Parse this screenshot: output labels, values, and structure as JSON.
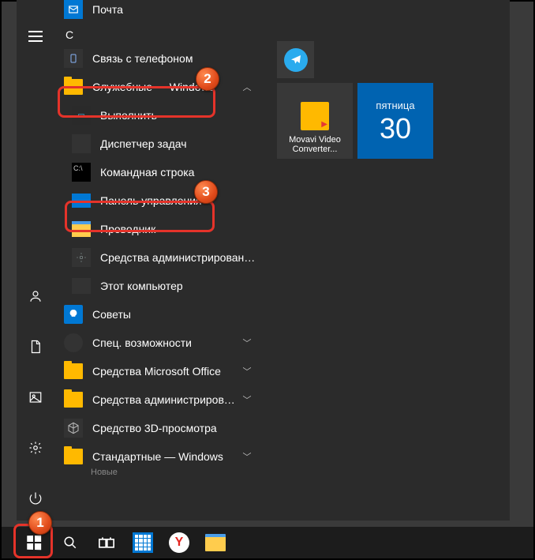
{
  "start_menu": {
    "letter_header": "С",
    "mail_label": "Почта",
    "items": [
      {
        "label": "Связь с телефоном",
        "type": "app"
      },
      {
        "label": "Служебные — Windows",
        "type": "folder-expandable",
        "expanded": true
      },
      {
        "label": "Выполнить",
        "type": "run",
        "sub": true
      },
      {
        "label": "Диспетчер задач",
        "type": "dark",
        "sub": true
      },
      {
        "label": "Командная строка",
        "type": "cmd",
        "sub": true
      },
      {
        "label": "Панель управления",
        "type": "cpl",
        "sub": true
      },
      {
        "label": "Проводник",
        "type": "exp",
        "sub": true
      },
      {
        "label": "Средства администрирования Wi...",
        "type": "settings",
        "sub": true
      },
      {
        "label": "Этот компьютер",
        "type": "pc",
        "sub": true
      },
      {
        "label": "Советы",
        "type": "tips"
      },
      {
        "label": "Спец. возможности",
        "type": "ease",
        "expand": true
      },
      {
        "label": "Средства Microsoft Office",
        "type": "folder",
        "expand": true
      },
      {
        "label": "Средства администрирования...",
        "type": "folder",
        "expand": true
      },
      {
        "label": "Средство 3D-просмотра",
        "type": "3d"
      },
      {
        "label": "Стандартные — Windows",
        "type": "folder",
        "expand": true
      }
    ],
    "new_label": "Новые"
  },
  "tiles": {
    "movavi": "Movavi Video Converter...",
    "calendar_day": "пятница",
    "calendar_num": "30"
  },
  "callouts": {
    "b1": "1",
    "b2": "2",
    "b3": "3"
  },
  "taskbar": {
    "yandex_letter": "Y"
  }
}
